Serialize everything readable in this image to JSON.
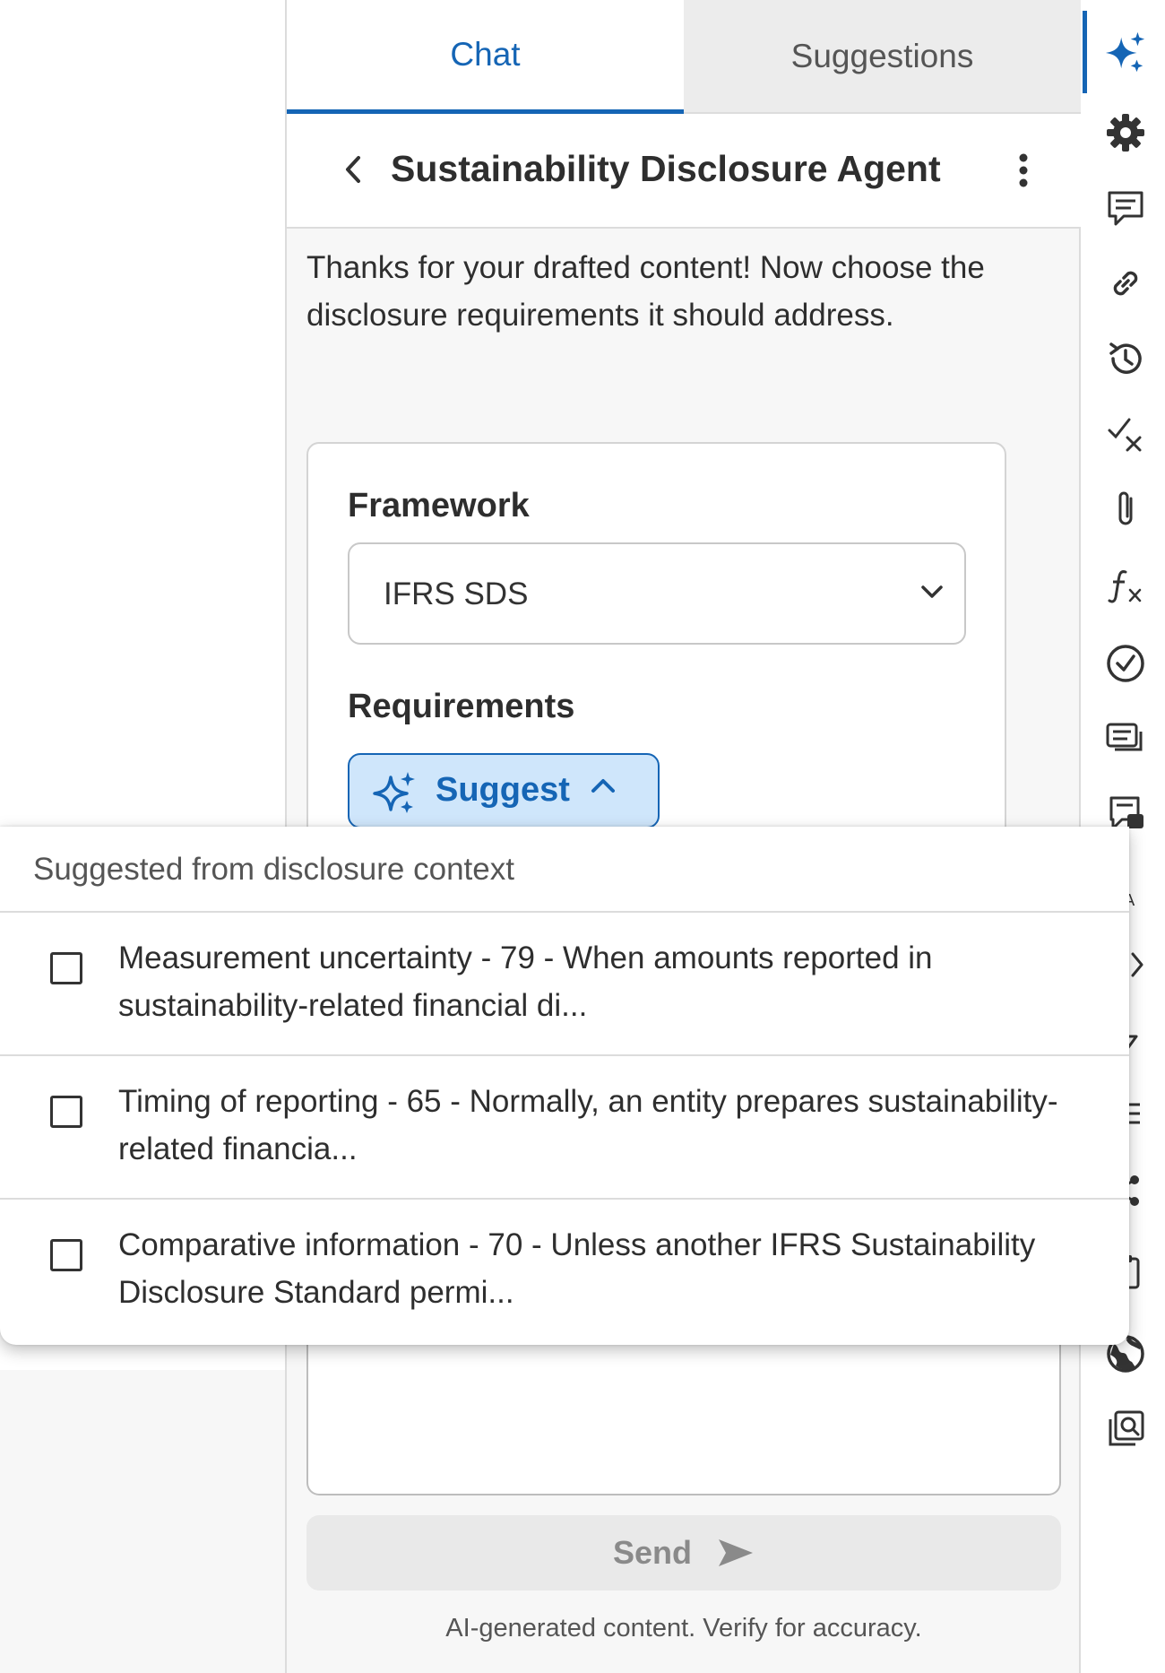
{
  "tabs": [
    {
      "label": "Chat",
      "active": true
    },
    {
      "label": "Suggestions",
      "active": false
    }
  ],
  "agent": {
    "title": "Sustainability Disclosure Agent",
    "back_icon": "chevron-left-icon",
    "more_icon": "more-vertical-icon"
  },
  "intro": "Thanks for your drafted content! Now choose the disclosure requirements it should address.",
  "form": {
    "framework_label": "Framework",
    "framework_value": "IFRS SDS",
    "requirements_label": "Requirements",
    "suggest_label": "Suggest"
  },
  "dropdown": {
    "header": "Suggested from disclosure context",
    "options": [
      {
        "text": "Measurement uncertainty - 79 - When amounts reported in sustainability-related financial di...",
        "checked": false
      },
      {
        "text": "Timing of reporting - 65 - Normally, an entity prepares sustainability-related financia...",
        "checked": false
      },
      {
        "text": "Comparative information - 70 - Unless another IFRS Sustainability Disclosure Standard permi...",
        "checked": false
      }
    ]
  },
  "send": {
    "label": "Send"
  },
  "disclaimer": "AI-generated content. Verify for accuracy.",
  "colors": {
    "accent": "#1565b5",
    "suggest_bg": "#cfe6fb",
    "panel_bg": "#f7f7f7"
  },
  "toolbar": {
    "icons": [
      "ai-sparkle-icon",
      "gear-icon",
      "comment-icon",
      "link-icon",
      "history-icon",
      "check-x-icon",
      "paperclip-icon",
      "formula-icon",
      "check-circle-icon",
      "messages-icon",
      "comment-filled-icon",
      "translate-icon",
      "code-icon",
      "lightning-icon",
      "outline-icon",
      "share-icon",
      "clipboard-icon",
      "globe-icon",
      "search-document-icon"
    ]
  }
}
